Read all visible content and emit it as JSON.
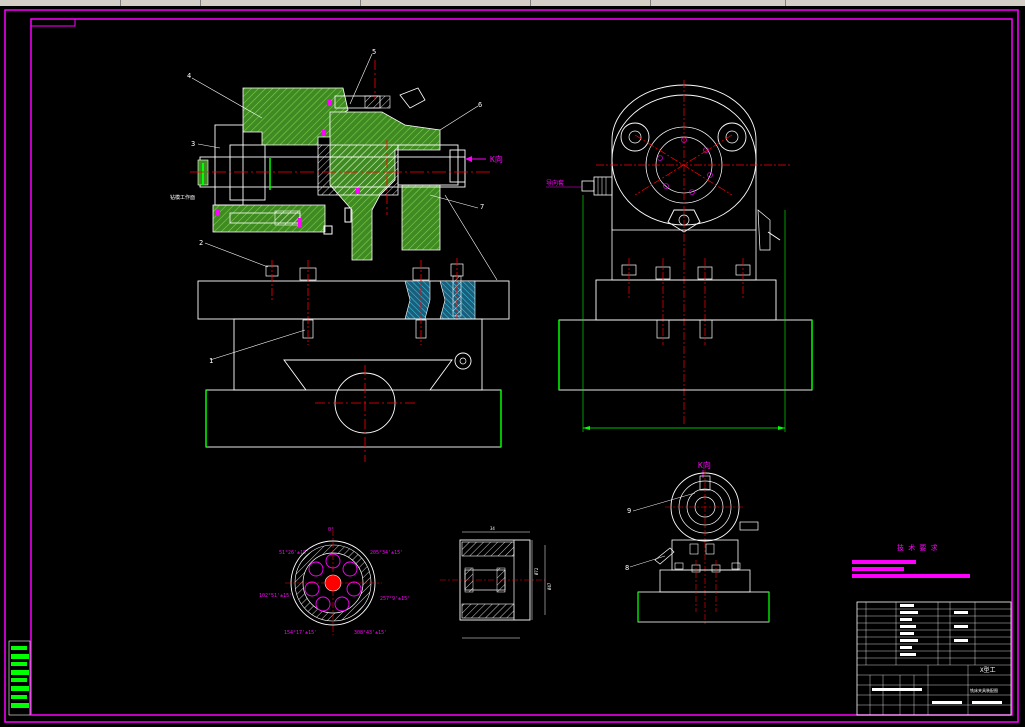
{
  "colors": {
    "background": "#000000",
    "frame": "#ff00ff",
    "outline": "#ffffff",
    "center_line": "#ff0000",
    "ground": "#00ff00",
    "hatch_green": "#4c9a2a",
    "hatch_cyan": "#2aa0c8",
    "callout": "#ff00ff",
    "toolbar": "#d4d0c8"
  },
  "view_front": {
    "callouts": [
      "1",
      "2",
      "3",
      "4",
      "5",
      "6",
      "7"
    ],
    "arrow_label": "K向",
    "side_note": "钻模工作面"
  },
  "view_side": {
    "tag": "导向套"
  },
  "view_k": {
    "title": "K向",
    "callouts": [
      "9",
      "8"
    ]
  },
  "plate_view": {
    "top_angle": "0°",
    "angles": [
      "51°26'±15'",
      "205°34'±15'",
      "102°51'±15'",
      "257°9'±15'",
      "154°17'±15'",
      "308°43'±15'"
    ]
  },
  "section_view": {
    "dims": [
      "34",
      "Ø72",
      "Ø47"
    ]
  },
  "tech_requirements": {
    "title": "技 术 要 求"
  },
  "title_block": {
    "drawing_name": "X型工",
    "part_desc": "铣床夹具装配图"
  }
}
